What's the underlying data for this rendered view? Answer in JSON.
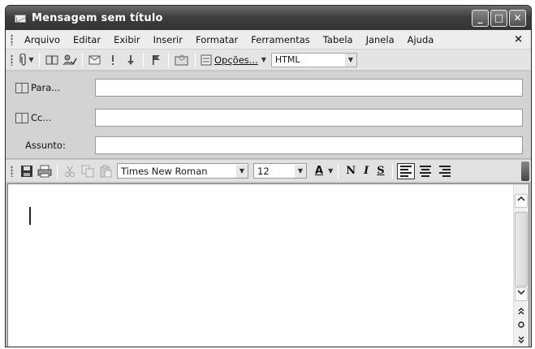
{
  "window": {
    "title": "Mensagem sem título",
    "minimize_glyph": "_",
    "maximize_glyph": "□",
    "close_glyph": "✕"
  },
  "menu": {
    "items": [
      {
        "label": "Arquivo"
      },
      {
        "label": "Editar"
      },
      {
        "label": "Exibir"
      },
      {
        "label": "Inserir"
      },
      {
        "label": "Formatar"
      },
      {
        "label": "Ferramentas"
      },
      {
        "label": "Tabela"
      },
      {
        "label": "Janela"
      },
      {
        "label": "Ajuda"
      }
    ],
    "close_glyph": "×"
  },
  "toolbar": {
    "options_label": "Opções...",
    "format_value": "HTML"
  },
  "address": {
    "to_label": "Para...",
    "cc_label": "Cc...",
    "subject_label": "Assunto:",
    "to_value": "",
    "cc_value": "",
    "subject_value": ""
  },
  "formatting": {
    "font_name": "Times New Roman",
    "font_size": "12",
    "bold_label": "N",
    "italic_label": "I",
    "underline_label": "S",
    "color_label": "A"
  },
  "editor": {
    "body_text": ""
  },
  "colors": {
    "titlebar": "#3f3f3f",
    "menubar": "#ededed",
    "panel": "#d3d3d3"
  }
}
